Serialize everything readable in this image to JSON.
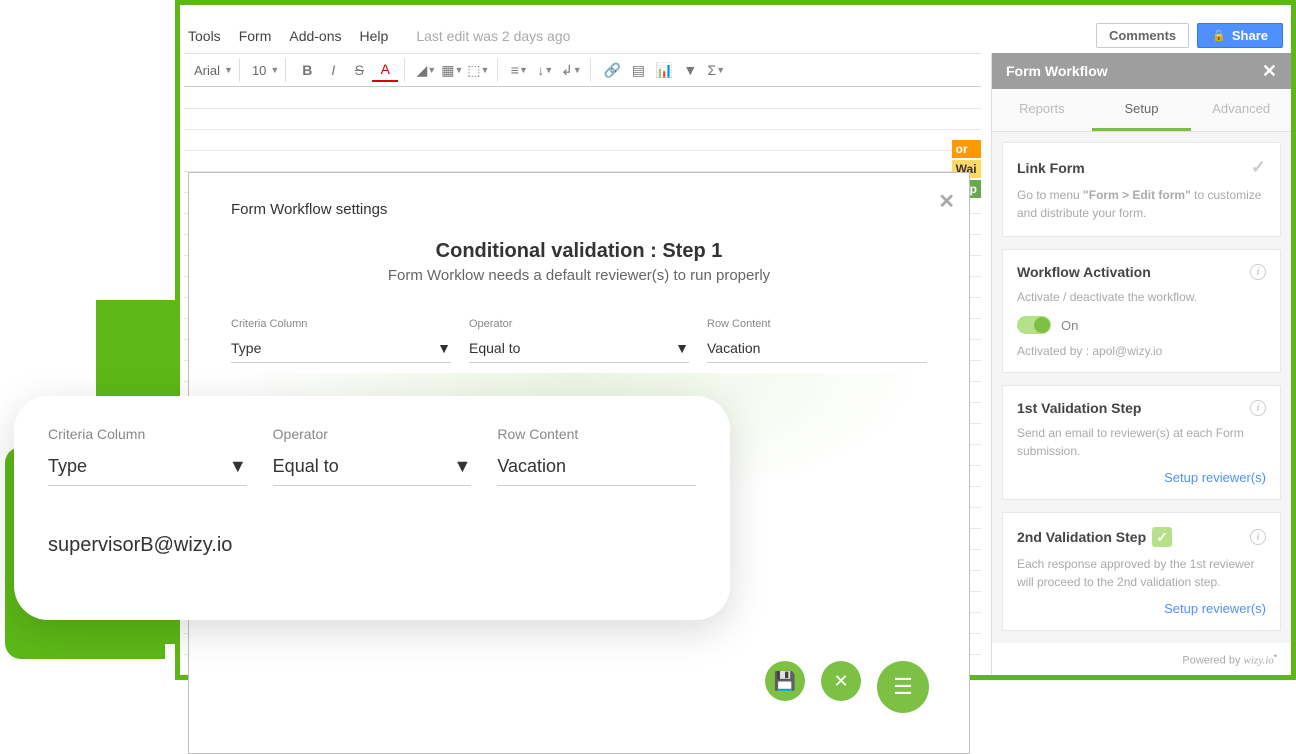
{
  "menu": {
    "items": [
      "Tools",
      "Form",
      "Add-ons",
      "Help"
    ],
    "status": "Last edit was 2 days ago",
    "comments": "Comments",
    "share": "Share"
  },
  "toolbar": {
    "font": "Arial",
    "size": "10"
  },
  "bg_cells": [
    {
      "text": "or",
      "bg": "#f90"
    },
    {
      "text": "Wai",
      "bg": "#ffd966"
    },
    {
      "text": "app",
      "bg": "#6aa84f"
    }
  ],
  "sidebar": {
    "title": "Form Workflow",
    "tabs": [
      "Reports",
      "Setup",
      "Advanced"
    ],
    "active_tab": 1,
    "cards": {
      "link": {
        "title": "Link Form",
        "text_pre": "Go to menu ",
        "text_bold": "\"Form > Edit form\"",
        "text_post": " to customize and distribute your form."
      },
      "activation": {
        "title": "Workflow Activation",
        "text": "Activate / deactivate the workflow.",
        "toggle_label": "On",
        "activated_by": "Activated by : apol@wizy.io"
      },
      "step1": {
        "title": "1st Validation Step",
        "text": "Send an email to reviewer(s) at each Form submission.",
        "link": "Setup reviewer(s)"
      },
      "step2": {
        "title": "2nd Validation Step",
        "text": "Each response approved by the 1st reviewer will proceed to the 2nd validation step.",
        "link": "Setup reviewer(s)"
      }
    },
    "powered_pre": "Powered by ",
    "powered_brand": "wizy.io"
  },
  "modal": {
    "label": "Form Workflow settings",
    "title": "Conditional validation : Step 1",
    "subtitle": "Form Worklow needs a default reviewer(s) to run properly",
    "fields": {
      "criteria": {
        "label": "Criteria Column",
        "value": "Type"
      },
      "operator": {
        "label": "Operator",
        "value": "Equal to"
      },
      "row": {
        "label": "Row Content",
        "value": "Vacation"
      }
    },
    "email": "supervisorB@wizy.io"
  },
  "zoom": {
    "fields": {
      "criteria": {
        "label": "Criteria Column",
        "value": "Type"
      },
      "operator": {
        "label": "Operator",
        "value": "Equal to"
      },
      "row": {
        "label": "Row Content",
        "value": "Vacation"
      }
    },
    "email": "supervisorB@wizy.io"
  }
}
